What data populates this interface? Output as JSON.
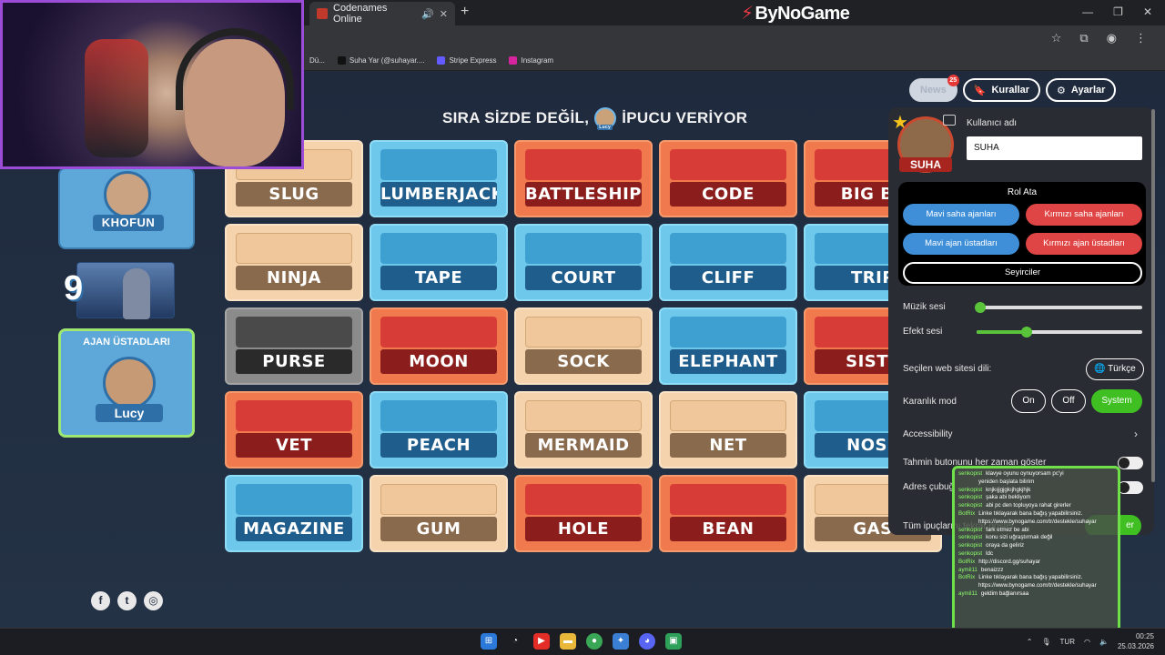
{
  "browser": {
    "tab_title": "Codenames Online",
    "brand": "ByNoGame",
    "bookmarks": [
      "Dü...",
      "Suha Yar (@suhayar....",
      "Stripe Express",
      "Instagram"
    ]
  },
  "game": {
    "turn_text_1": "SIRA SİZDE DEĞİL,",
    "turn_text_2": "İPUCU VERİYOR",
    "turn_avatar_label": "Lucy",
    "agents": {
      "name": "KHOFUN"
    },
    "count": "9",
    "spymasters": {
      "title": "AJAN ÜSTADLARI",
      "name": "Lucy"
    },
    "cards": [
      {
        "word": "SLUG",
        "team": "neutral"
      },
      {
        "word": "LUMBERJACK",
        "team": "blue"
      },
      {
        "word": "BATTLESHIP",
        "team": "red"
      },
      {
        "word": "CODE",
        "team": "red"
      },
      {
        "word": "BIG BE",
        "team": "red"
      },
      {
        "word": "NINJA",
        "team": "neutral"
      },
      {
        "word": "TAPE",
        "team": "blue"
      },
      {
        "word": "COURT",
        "team": "blue"
      },
      {
        "word": "CLIFF",
        "team": "blue"
      },
      {
        "word": "TRIP",
        "team": "blue"
      },
      {
        "word": "PURSE",
        "team": "assassin"
      },
      {
        "word": "MOON",
        "team": "red"
      },
      {
        "word": "SOCK",
        "team": "neutral"
      },
      {
        "word": "ELEPHANT",
        "team": "blue"
      },
      {
        "word": "SISTE",
        "team": "red"
      },
      {
        "word": "VET",
        "team": "red"
      },
      {
        "word": "PEACH",
        "team": "blue"
      },
      {
        "word": "MERMAID",
        "team": "neutral"
      },
      {
        "word": "NET",
        "team": "neutral"
      },
      {
        "word": "NOSE",
        "team": "blue"
      },
      {
        "word": "MAGAZINE",
        "team": "blue"
      },
      {
        "word": "GUM",
        "team": "neutral"
      },
      {
        "word": "HOLE",
        "team": "red"
      },
      {
        "word": "BEAN",
        "team": "red"
      },
      {
        "word": "GAS",
        "team": "neutral"
      }
    ]
  },
  "topbar": {
    "news_label": "News",
    "news_badge": "25",
    "rules_label": "Kurallar",
    "settings_label": "Ayarlar"
  },
  "settings": {
    "avatar_name": "SUHA",
    "username_label": "Kullanıcı adı",
    "username_value": "SUHA",
    "role_title": "Rol Ata",
    "role_blue_agents": "Mavi saha ajanları",
    "role_red_agents": "Kırmızı saha ajanları",
    "role_blue_masters": "Mavi ajan üstadları",
    "role_red_masters": "Kırmızı ajan üstadları",
    "role_spectators": "Seyirciler",
    "music_label": "Müzik sesi",
    "music_level": 0,
    "effect_label": "Efekt sesi",
    "effect_level": 0.3,
    "site_lang_label": "Seçilen web sitesi dili:",
    "site_lang_value": "Türkçe",
    "dark_label": "Karanlık mod",
    "dark_on": "On",
    "dark_off": "Off",
    "dark_system": "System",
    "accessibility_label": "Accessibility",
    "guess_btn_label": "Tahmin butonunu her zaman göster",
    "address_bar_label": "Adres çubuğ",
    "all_hints_label": "Tüm ipuçlarını tekrar göster",
    "green_btn": "er"
  },
  "chat": [
    {
      "user": "senkopist",
      "text": "klavye oyunu oynuyorsam pc'yi"
    },
    {
      "user": "",
      "text": "yeniden başlata bilirim"
    },
    {
      "user": "senkopist",
      "text": "knjkıjjgjgkıjhgkjhjk"
    },
    {
      "user": "senkopist",
      "text": "şaka abi bekliyom"
    },
    {
      "user": "senkopist",
      "text": "abi pc den topluyoya rahat girerler"
    },
    {
      "user": "BotRix",
      "text": "Linke tıklayarak bana bağış yapabilirsiniz."
    },
    {
      "user": "",
      "text": "https://www.bynogame.com/tr/destekle/suhayar"
    },
    {
      "user": "senkopist",
      "text": "fark etmez be abi"
    },
    {
      "user": "senkopist",
      "text": "konu sizi uğraştırmak değil"
    },
    {
      "user": "senkopist",
      "text": "oraya da geliriz"
    },
    {
      "user": "senkopist",
      "text": "ldc"
    },
    {
      "user": "BotRix",
      "text": "http://discord.gg/suhayar"
    },
    {
      "user": "aymil11",
      "text": "benaizzz"
    },
    {
      "user": "BotRix",
      "text": "Linke tıklayarak bana bağış yapabilirsiniz."
    },
    {
      "user": "",
      "text": "https://www.bynogame.com/tr/destekle/suhayar"
    },
    {
      "user": "aymil11",
      "text": "geldim bağlanırsaa"
    }
  ],
  "taskbar": {
    "lang": "TUR",
    "time": "00:25",
    "date": "25.03.2026"
  }
}
